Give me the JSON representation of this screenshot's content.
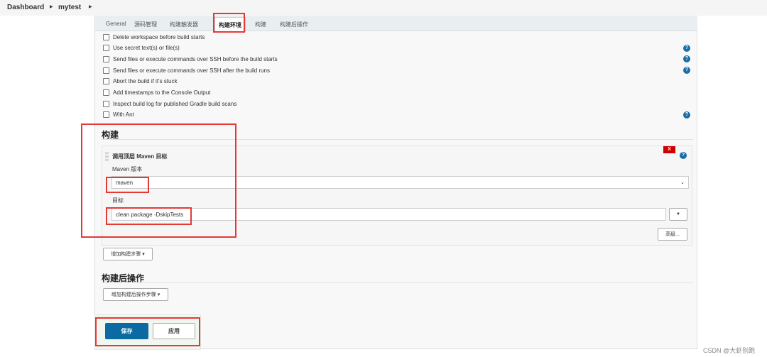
{
  "breadcrumb": {
    "items": [
      "Dashboard",
      "mytest"
    ]
  },
  "tabs": [
    "General",
    "源码管理",
    "构建触发器",
    "构建环境",
    "构建",
    "构建后操作"
  ],
  "active_tab": "构建环境",
  "build_env_options": [
    {
      "label": "Delete workspace before build starts",
      "checked": false,
      "help": false
    },
    {
      "label": "Use secret text(s) or file(s)",
      "checked": false,
      "help": true
    },
    {
      "label": "Send files or execute commands over SSH before the build starts",
      "checked": false,
      "help": true
    },
    {
      "label": "Send files or execute commands over SSH after the build runs",
      "checked": false,
      "help": true
    },
    {
      "label": "Abort the build if it's stuck",
      "checked": false,
      "help": false
    },
    {
      "label": "Add timestamps to the Console Output",
      "checked": false,
      "help": false
    },
    {
      "label": "Inspect build log for published Gradle build scans",
      "checked": false,
      "help": false
    },
    {
      "label": "With Ant",
      "checked": false,
      "help": true
    }
  ],
  "build": {
    "title": "构建",
    "step": {
      "title": "调用顶层 Maven 目标",
      "delete_label": "X",
      "maven_version_label": "Maven 版本",
      "maven_version_value": "maven",
      "goals_label": "目标",
      "goals_value": "clean package -DskipTests",
      "advanced_label": "高级..."
    },
    "add_step_label": "增加构建步骤"
  },
  "post_build": {
    "title": "构建后操作",
    "add_step_label": "增加构建后操作步骤"
  },
  "actions": {
    "save": "保存",
    "apply": "应用"
  },
  "watermark": "CSDN @大虾别跑",
  "colors": {
    "save_button": "#0b6aa2",
    "annotation": "#e53935",
    "delete": "#cc0000"
  }
}
